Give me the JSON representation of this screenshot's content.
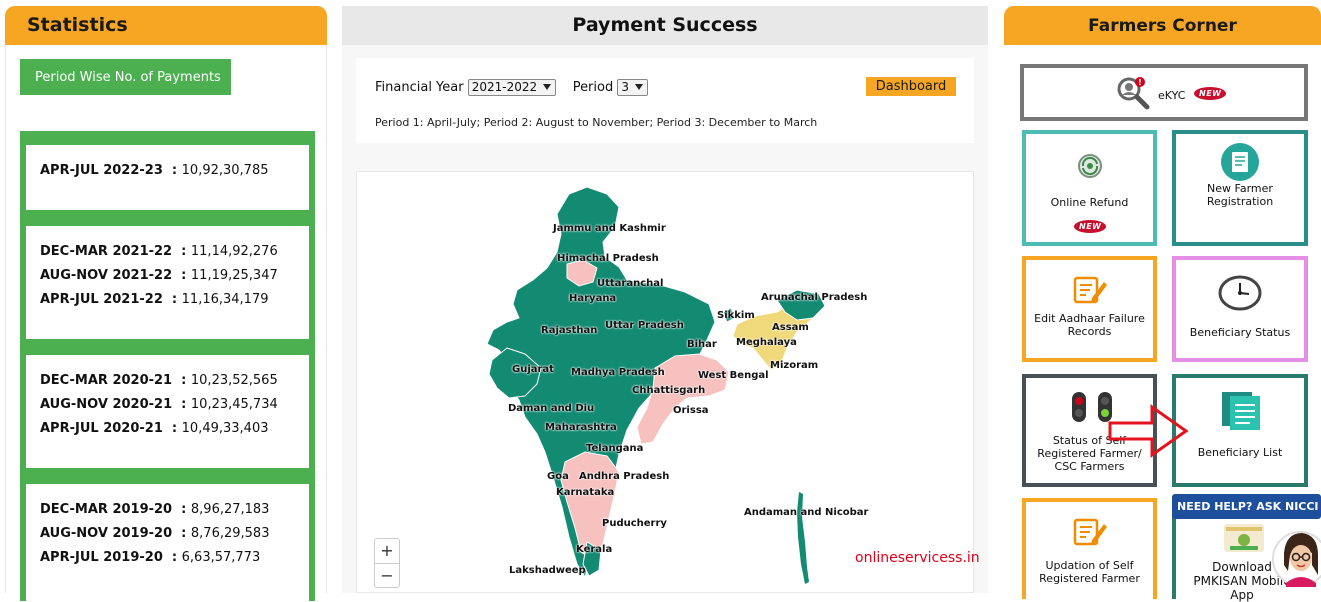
{
  "statistics": {
    "title": "Statistics",
    "period_button": "Period Wise No. of Payments",
    "groups": [
      [
        {
          "label": "APR-JUL 2022-23",
          "value": "10,92,30,785"
        }
      ],
      [
        {
          "label": "DEC-MAR 2021-22",
          "value": "11,14,92,276"
        },
        {
          "label": "AUG-NOV 2021-22",
          "value": "11,19,25,347"
        },
        {
          "label": "APR-JUL 2021-22",
          "value": "11,16,34,179"
        }
      ],
      [
        {
          "label": "DEC-MAR 2020-21",
          "value": "10,23,52,565"
        },
        {
          "label": "AUG-NOV 2020-21",
          "value": "10,23,45,734"
        },
        {
          "label": "APR-JUL 2020-21",
          "value": "10,49,33,403"
        }
      ],
      [
        {
          "label": "DEC-MAR 2019-20",
          "value": "8,96,27,183"
        },
        {
          "label": "AUG-NOV 2019-20",
          "value": "8,76,29,583"
        },
        {
          "label": "APR-JUL 2019-20",
          "value": "6,63,57,773"
        }
      ]
    ]
  },
  "payment": {
    "title": "Payment Success",
    "financial_year_label": "Financial Year",
    "financial_year_value": "2021-2022",
    "period_label": "Period",
    "period_value": "3",
    "dashboard_button": "Dashboard",
    "period_note": "Period 1: April-July; Period 2: August to November; Period 3: December to March",
    "zoom_in": "+",
    "zoom_out": "−",
    "watermark": "onlineservicess.in",
    "map_labels": {
      "jammu": "Jammu and Kashmir",
      "himachal": "Himachal Pradesh",
      "uttaranchal": "Uttaranchal",
      "haryana": "Haryana",
      "arunachal": "Arunachal Pradesh",
      "sikkim": "Sikkim",
      "assam": "Assam",
      "rajasthan": "Rajasthan",
      "uttar": "Uttar Pradesh",
      "meghalaya": "Meghalaya",
      "bihar": "Bihar",
      "gujarat": "Gujarat",
      "madhya": "Madhya Pradesh",
      "westbengal": "West Bengal",
      "mizoram": "Mizoram",
      "chhattisgarh": "Chhattisgarh",
      "damandiu": "Daman and Diu",
      "orissa": "Orissa",
      "maharashtra": "Maharashtra",
      "telangana": "Telangana",
      "goa": "Goa",
      "andhra": "Andhra Pradesh",
      "karnataka": "Karnataka",
      "andaman": "Andaman and Nicobar",
      "puducherry": "Puducherry",
      "kerala": "Kerala",
      "lakshadweep": "Lakshadweep"
    },
    "colors": {
      "high": "#138a72",
      "medium": "#f0d97a",
      "low": "#f6c1bf"
    }
  },
  "farmers_corner": {
    "title": "Farmers Corner",
    "ekyc": "eKYC",
    "new_badge": "NEW",
    "online_refund": "Online Refund",
    "new_farmer_line1": "New Farmer",
    "new_farmer_line2": "Registration",
    "edit_aadhaar_line1": "Edit Aadhaar Failure",
    "edit_aadhaar_line2": "Records",
    "beneficiary_status": "Beneficiary Status",
    "status_self_line1": "Status of Self",
    "status_self_line2": "Registered Farmer/",
    "status_self_line3": "CSC Farmers",
    "beneficiary_list": "Beneficiary List",
    "updation_line1": "Updation of Self",
    "updation_line2": "Registered Farmer",
    "download_line1": "Download",
    "download_line2": "PMKISAN Mobile",
    "download_line3": "App",
    "help_banner": "NEED HELP? ASK NICCI"
  }
}
